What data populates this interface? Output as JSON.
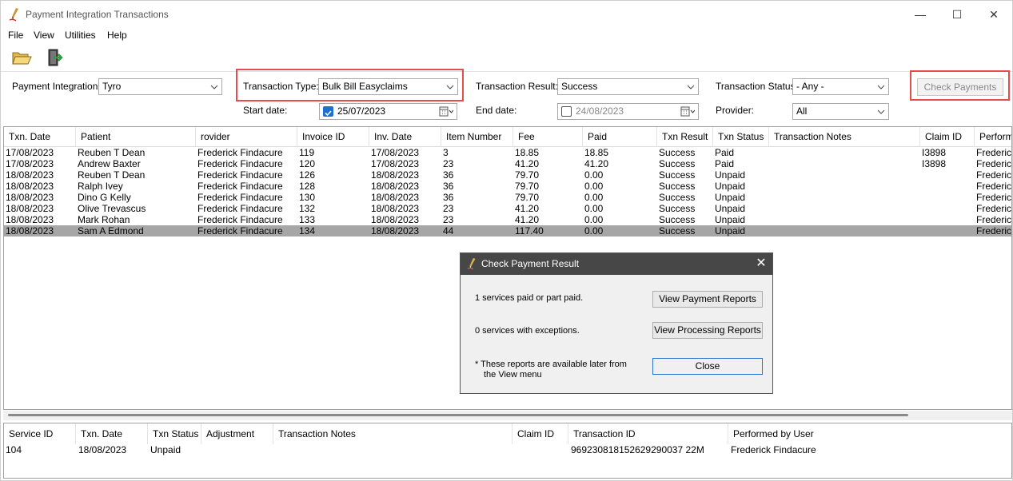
{
  "window": {
    "title": "Payment Integration Transactions",
    "controls": {
      "minimize": "—",
      "maximize": "☐",
      "close": "✕"
    }
  },
  "menu": [
    "File",
    "View",
    "Utilities",
    "Help"
  ],
  "toolbar": {
    "open_icon": "folder-open-icon",
    "exit_icon": "exit-door-icon"
  },
  "filters": {
    "payment_integration": {
      "label": "Payment Integration:",
      "value": "Tyro"
    },
    "transaction_type": {
      "label": "Transaction Type:",
      "value": "Bulk Bill Easyclaims"
    },
    "transaction_result": {
      "label": "Transaction Result:",
      "value": "Success"
    },
    "transaction_status": {
      "label": "Transaction Status:",
      "value": "- Any -"
    },
    "start_date": {
      "label": "Start date:",
      "value": "25/07/2023",
      "checked": true
    },
    "end_date": {
      "label": "End date:",
      "value": "24/08/2023",
      "checked": false
    },
    "provider": {
      "label": "Provider:",
      "value": "All"
    },
    "check_payments": "Check Payments"
  },
  "grid": {
    "columns": [
      "Txn. Date",
      "Patient",
      "rovider",
      "Invoice ID",
      "Inv. Date",
      "Item Number",
      "Fee",
      "Paid",
      "Txn Result",
      "Txn Status",
      "Transaction Notes",
      "Claim ID",
      "Performe"
    ],
    "rows": [
      [
        "17/08/2023",
        "Reuben T Dean",
        "Frederick Findacure",
        "119",
        "17/08/2023",
        "3",
        "18.85",
        "18.85",
        "Success",
        "Paid",
        "",
        "I3898",
        "Frederick"
      ],
      [
        "17/08/2023",
        "Andrew Baxter",
        "Frederick Findacure",
        "120",
        "17/08/2023",
        "23",
        "41.20",
        "41.20",
        "Success",
        "Paid",
        "",
        "I3898",
        "Frederick"
      ],
      [
        "18/08/2023",
        "Reuben T Dean",
        "Frederick Findacure",
        "126",
        "18/08/2023",
        "36",
        "79.70",
        "0.00",
        "Success",
        "Unpaid",
        "",
        "",
        "Frederick"
      ],
      [
        "18/08/2023",
        "Ralph Ivey",
        "Frederick Findacure",
        "128",
        "18/08/2023",
        "36",
        "79.70",
        "0.00",
        "Success",
        "Unpaid",
        "",
        "",
        "Frederick"
      ],
      [
        "18/08/2023",
        "Dino G Kelly",
        "Frederick Findacure",
        "130",
        "18/08/2023",
        "36",
        "79.70",
        "0.00",
        "Success",
        "Unpaid",
        "",
        "",
        "Frederick"
      ],
      [
        "18/08/2023",
        "Olive Trevascus",
        "Frederick Findacure",
        "132",
        "18/08/2023",
        "23",
        "41.20",
        "0.00",
        "Success",
        "Unpaid",
        "",
        "",
        "Frederick"
      ],
      [
        "18/08/2023",
        "Mark Rohan",
        "Frederick Findacure",
        "133",
        "18/08/2023",
        "23",
        "41.20",
        "0.00",
        "Success",
        "Unpaid",
        "",
        "",
        "Frederick"
      ],
      [
        "18/08/2023",
        "Sam A Edmond",
        "Frederick Findacure",
        "134",
        "18/08/2023",
        "44",
        "117.40",
        "0.00",
        "Success",
        "Unpaid",
        "",
        "",
        "Frederick"
      ]
    ],
    "selected_row": 7
  },
  "detail_grid": {
    "columns": [
      "Service ID",
      "Txn. Date",
      "Txn Status",
      "Adjustment",
      "Transaction Notes",
      "Claim ID",
      "Transaction ID",
      "Performed by User"
    ],
    "rows": [
      [
        "104",
        "18/08/2023",
        "Unpaid",
        "",
        "",
        "",
        "969230818152629290037 22M",
        "Frederick Findacure"
      ]
    ]
  },
  "dialog": {
    "title": "Check Payment Result",
    "close": "✕",
    "paid_text": "1 services paid or part paid.",
    "exceptions_text": "0 services with exceptions.",
    "note_line1": "* These reports are available later from",
    "note_line2": "the View menu",
    "view_payment_reports": "View Payment Reports",
    "view_processing_reports": "View Processing Reports",
    "close_button": "Close"
  },
  "colors": {
    "highlight": "#e74c4c",
    "selected_row": "#a6a6a6",
    "dialog_title": "#474747",
    "checkbox": "#1f6fd1"
  }
}
